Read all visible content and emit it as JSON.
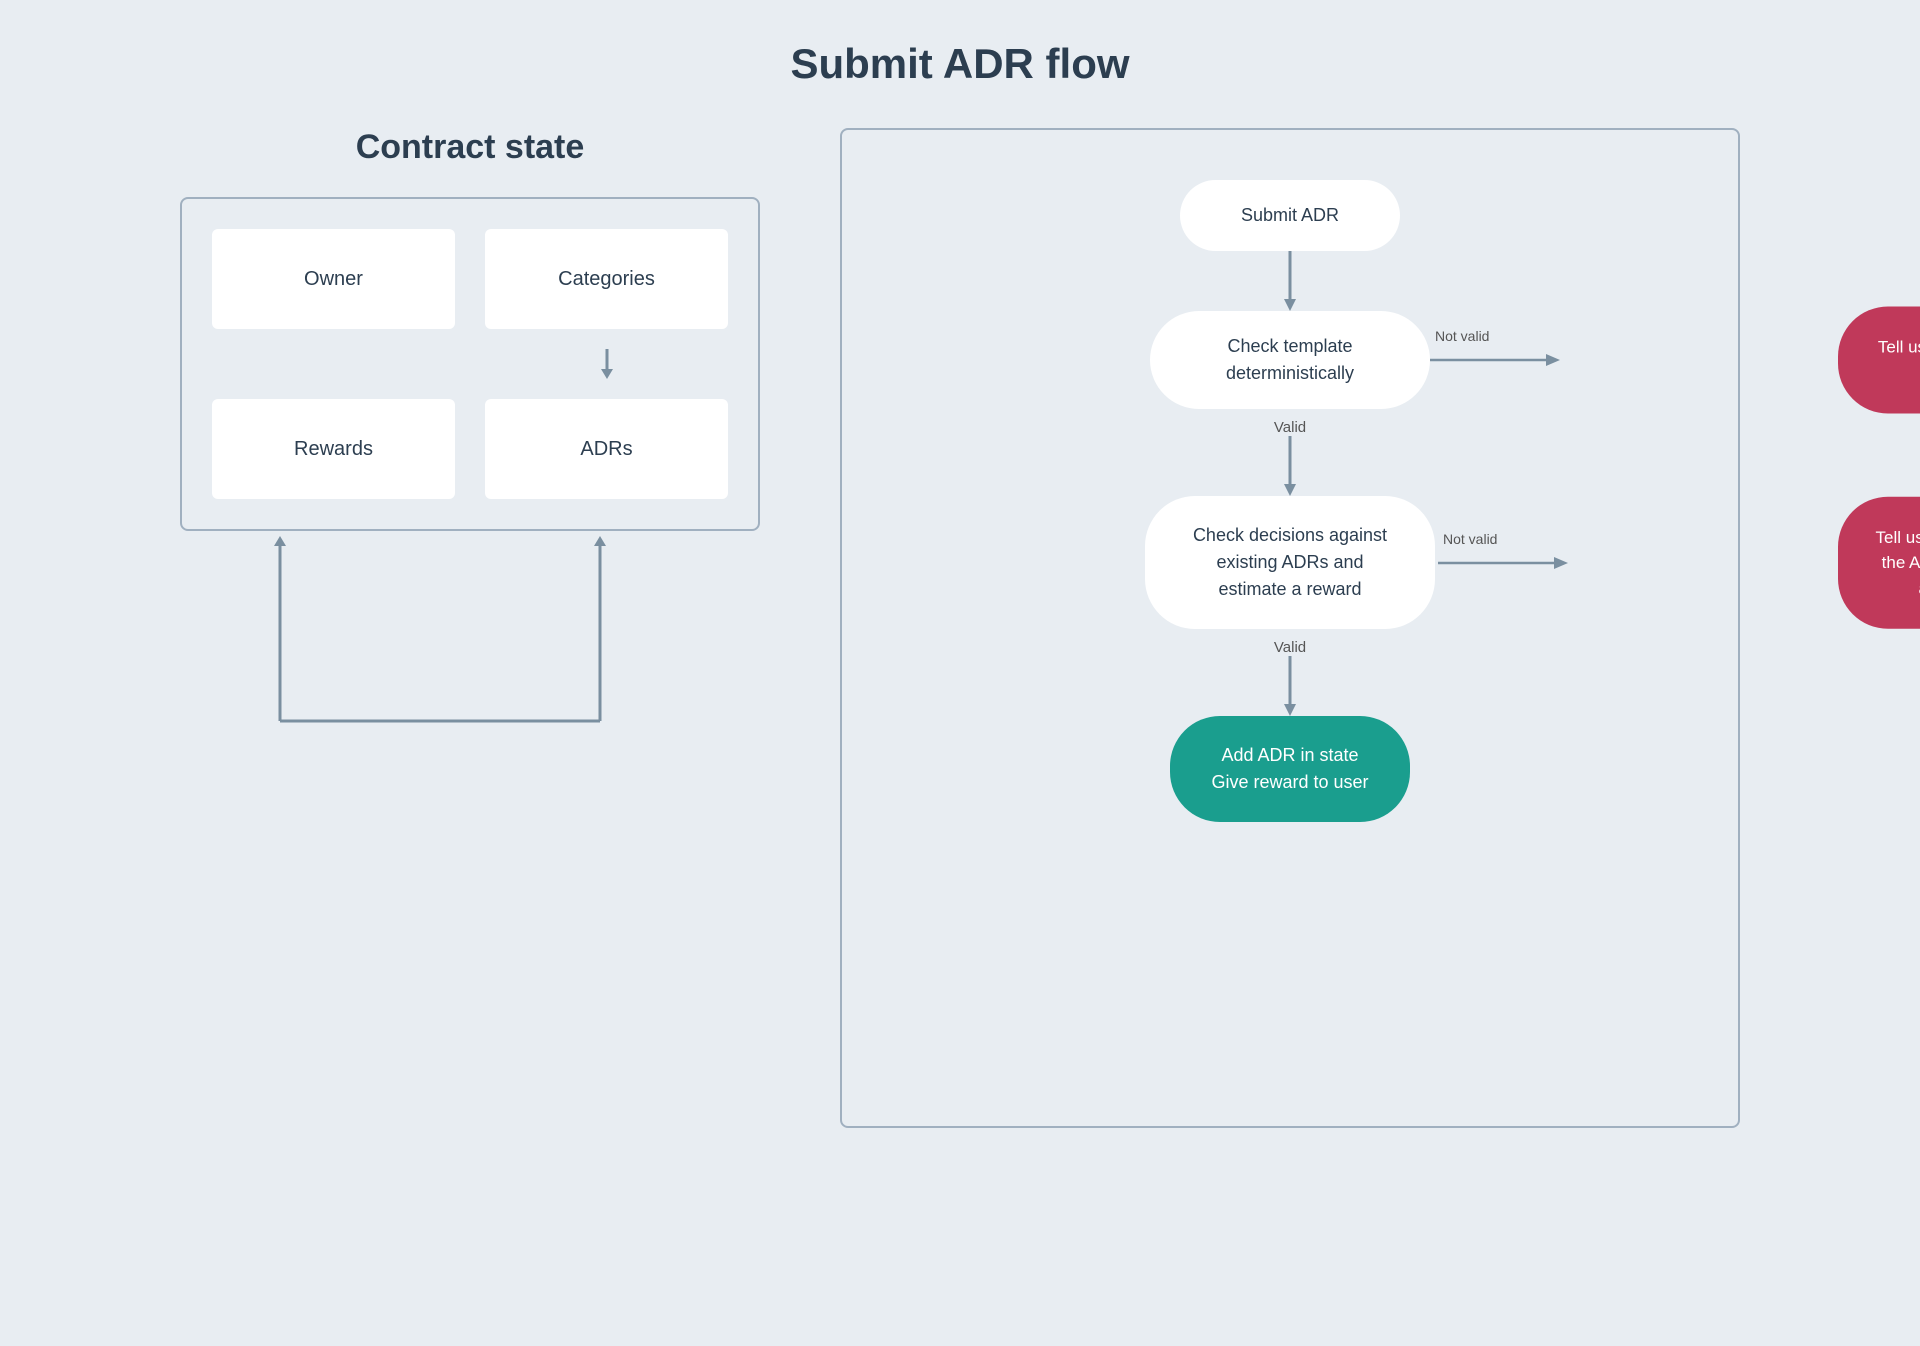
{
  "page": {
    "title": "Submit ADR flow"
  },
  "contract_state": {
    "title": "Contract state",
    "nodes": [
      {
        "id": "owner",
        "label": "Owner"
      },
      {
        "id": "categories",
        "label": "Categories"
      },
      {
        "id": "rewards",
        "label": "Rewards"
      },
      {
        "id": "adrs",
        "label": "ADRs"
      }
    ]
  },
  "adr_flow": {
    "nodes": [
      {
        "id": "submit-adr",
        "label": "Submit ADR"
      },
      {
        "id": "check-template",
        "label": "Check template deterministically"
      },
      {
        "id": "check-decisions",
        "label": "Check decisions against existing ADRs and estimate a reward"
      },
      {
        "id": "add-adr",
        "label": "Add ADR in state\nGive reward to user"
      }
    ],
    "labels": {
      "valid1": "Valid",
      "valid2": "Valid",
      "not_valid1": "Not valid",
      "not_valid2": "Not valid"
    },
    "error_nodes": [
      {
        "id": "error-template",
        "label": "Tell user template is wrong"
      },
      {
        "id": "error-adr",
        "label": "Tell user reason why the ADR cannot be accepted"
      }
    ]
  },
  "colors": {
    "background": "#e8edf2",
    "teal": "#1a9e8e",
    "error_red": "#c0395a",
    "arrow": "#7a8fa0",
    "node_bg": "#ffffff",
    "text_dark": "#2c3e50",
    "border": "#a0b0c0"
  }
}
